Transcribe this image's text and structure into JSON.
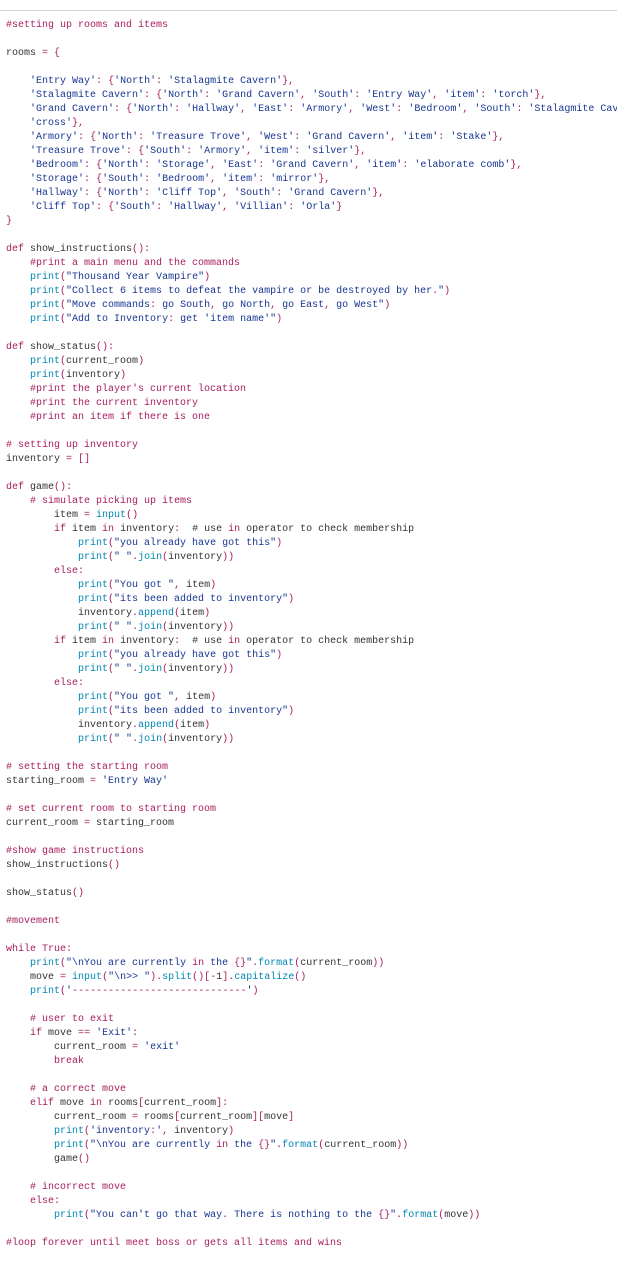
{
  "code": {
    "l01": "#setting up rooms and items",
    "l02": "",
    "l03": "rooms = {",
    "l04": "",
    "l05": "    'Entry Way': {'North': 'Stalagmite Cavern'},",
    "l06": "    'Stalagmite Cavern': {'North': 'Grand Cavern', 'South': 'Entry Way', 'item': 'torch'},",
    "l07": "    'Grand Cavern': {'North': 'Hallway', 'East': 'Armory', 'West': 'Bedroom', 'South': 'Stalagmite Cavern', 'item':",
    "l08": "    'cross'},",
    "l09": "    'Armory': {'North': 'Treasure Trove', 'West': 'Grand Cavern', 'item': 'Stake'},",
    "l10": "    'Treasure Trove': {'South': 'Armory', 'item': 'silver'},",
    "l11": "    'Bedroom': {'North': 'Storage', 'East': 'Grand Cavern', 'item': 'elaborate comb'},",
    "l12": "    'Storage': {'South': 'Bedroom', 'item': 'mirror'},",
    "l13": "    'Hallway': {'North': 'Cliff Top', 'South': 'Grand Cavern'},",
    "l14": "    'Cliff Top': {'South': 'Hallway', 'Villian': 'Orla'}",
    "l15": "}",
    "l16": "",
    "l17": "def show_instructions():",
    "l18": "    #print a main menu and the commands",
    "l19": "    print(\"Thousand Year Vampire\")",
    "l20": "    print(\"Collect 6 items to defeat the vampire or be destroyed by her.\")",
    "l21": "    print(\"Move commands: go South, go North, go East, go West\")",
    "l22": "    print(\"Add to Inventory: get 'item name'\")",
    "l23": "",
    "l24": "def show_status():",
    "l25": "    print(current_room)",
    "l26": "    print(inventory)",
    "l27": "    #print the player's current location",
    "l28": "    #print the current inventory",
    "l29": "    #print an item if there is one",
    "l30": "",
    "l31": "# setting up inventory",
    "l32": "inventory = []",
    "l33": "",
    "l34": "def game():",
    "l35": "    # simulate picking up items",
    "l36": "        item = input()",
    "l37": "        if item in inventory:  # use in operator to check membership",
    "l38": "            print(\"you already have got this\")",
    "l39": "            print(\" \".join(inventory))",
    "l40": "        else:",
    "l41": "            print(\"You got \", item)",
    "l42": "            print(\"its been added to inventory\")",
    "l43": "            inventory.append(item)",
    "l44": "            print(\" \".join(inventory))",
    "l45": "        if item in inventory:  # use in operator to check membership",
    "l46": "            print(\"you already have got this\")",
    "l47": "            print(\" \".join(inventory))",
    "l48": "        else:",
    "l49": "            print(\"You got \", item)",
    "l50": "            print(\"its been added to inventory\")",
    "l51": "            inventory.append(item)",
    "l52": "            print(\" \".join(inventory))",
    "l53": "",
    "l54": "# setting the starting room",
    "l55": "starting_room = 'Entry Way'",
    "l56": "",
    "l57": "# set current room to starting room",
    "l58": "current_room = starting_room",
    "l59": "",
    "l60": "#show game instructions",
    "l61": "show_instructions()",
    "l62": "",
    "l63": "show_status()",
    "l64": "",
    "l65": "#movement",
    "l66": "",
    "l67": "while True:",
    "l68": "    print(\"\\nYou are currently in the {}\".format(current_room))",
    "l69": "    move = input(\"\\n>> \").split()[-1].capitalize()",
    "l70": "    print('-----------------------------')",
    "l71": "",
    "l72": "    # user to exit",
    "l73": "    if move == 'Exit':",
    "l74": "        current_room = 'exit'",
    "l75": "        break",
    "l76": "",
    "l77": "    # a correct move",
    "l78": "    elif move in rooms[current_room]:",
    "l79": "        current_room = rooms[current_room][move]",
    "l80": "        print('inventory:', inventory)",
    "l81": "        print(\"\\nYou are currently in the {}\".format(current_room))",
    "l82": "        game()",
    "l83": "",
    "l84": "    # incorrect move",
    "l85": "    else:",
    "l86": "        print(\"You can't go that way. There is nothing to the {}\".format(move))",
    "l87": "",
    "l88": "#loop forever until meet boss or gets all items and wins"
  }
}
